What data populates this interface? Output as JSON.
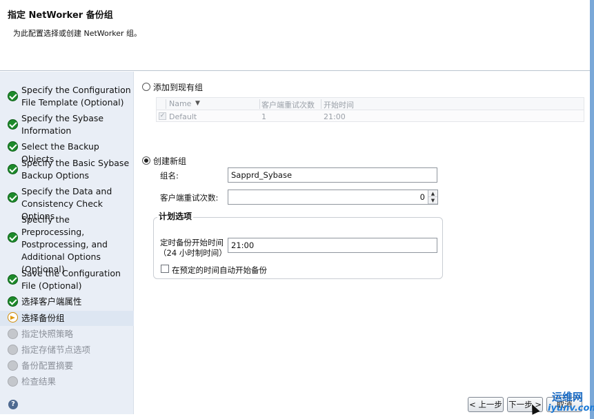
{
  "header": {
    "title": "指定 NetWorker 备份组",
    "subtitle": "为此配置选择或创建 NetWorker 组。"
  },
  "sidebar": {
    "steps": [
      {
        "label": "Specify the Configuration File Template (Optional)",
        "status": "done"
      },
      {
        "label": "Specify the Sybase Information",
        "status": "done"
      },
      {
        "label": "Select the Backup Objects",
        "status": "done"
      },
      {
        "label": "Specify the Basic Sybase Backup Options",
        "status": "done"
      },
      {
        "label": "Specify the Data and Consistency Check Options",
        "status": "done"
      },
      {
        "label": "Specify the Preprocessing, Postprocessing, and Additional Options (Optional)",
        "status": "done"
      },
      {
        "label": "Save the Configuration File (Optional)",
        "status": "done"
      },
      {
        "label": "选择客户端属性",
        "status": "done"
      },
      {
        "label": "选择备份组",
        "status": "current"
      },
      {
        "label": "指定快照策略",
        "status": "todo"
      },
      {
        "label": "指定存储节点选项",
        "status": "todo"
      },
      {
        "label": "备份配置摘要",
        "status": "todo"
      },
      {
        "label": "检查结果",
        "status": "todo"
      }
    ],
    "help_glyph": "?"
  },
  "existing_group": {
    "radio_label": "添加到现有组",
    "selected": false,
    "columns": [
      "Name",
      "客户端重试次数",
      "开始时间"
    ],
    "sort_glyph": "▼",
    "rows": [
      {
        "checked": true,
        "name": "Default",
        "retries": "1",
        "start_time": "21:00"
      }
    ]
  },
  "new_group": {
    "radio_label": "创建新组",
    "selected": true,
    "group_name_label": "组名:",
    "group_name_value": "Sapprd_Sybase",
    "retries_label": "客户端重试次数:",
    "retries_value": "0",
    "schedule": {
      "title": "计划选项",
      "start_time_label_line1": "定时备份开始时间",
      "start_time_label_line2": "（24 小时制时间）",
      "start_time_value": "21:00",
      "auto_start_label": "在预定的时间自动开始备份",
      "auto_start_checked": false
    }
  },
  "footer": {
    "back_label": "< 上一步",
    "next_label": "下一步 >",
    "cancel_label": "取消"
  },
  "watermark": {
    "line1": "运维网",
    "line2": "iyunv.com"
  }
}
